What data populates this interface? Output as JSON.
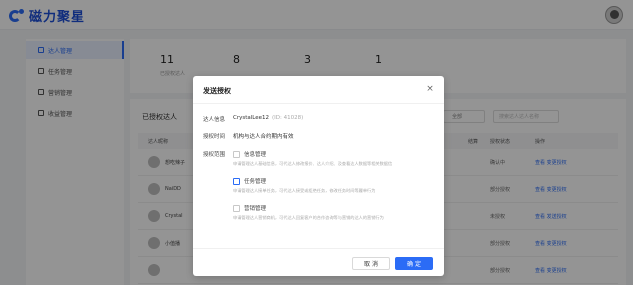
{
  "app": {
    "brand": "磁力聚星"
  },
  "sidebar": {
    "items": [
      {
        "label": "达人管理",
        "active": true
      },
      {
        "label": "任务管理",
        "active": false
      },
      {
        "label": "营销管理",
        "active": false
      },
      {
        "label": "收益管理",
        "active": false
      }
    ]
  },
  "stats": [
    {
      "value": "11",
      "label": "已授权达人"
    },
    {
      "value": "8",
      "label": ""
    },
    {
      "value": "3",
      "label": ""
    },
    {
      "value": "1",
      "label": ""
    }
  ],
  "list": {
    "title": "已授权达人",
    "filter_value": "全部",
    "search_placeholder": "搜索达人达人名称",
    "columns": {
      "name": "达人昵称",
      "settle": "结算",
      "status": "授权状态",
      "action": "操作"
    },
    "rows": [
      {
        "name": "想吃辣子",
        "status": "确认中",
        "op": "查看 变更授权"
      },
      {
        "name": "NaiDD",
        "status": "部分授权",
        "op": "查看 变更授权"
      },
      {
        "name": "Crystal",
        "status": "未授权",
        "op": "查看 发送授权"
      },
      {
        "name": "小值播",
        "status": "部分授权",
        "op": "查看 变更授权"
      },
      {
        "name": "",
        "status": "部分授权",
        "op": "查看 变更授权"
      }
    ]
  },
  "modal": {
    "title": "发送授权",
    "close_symbol": "×",
    "info_label": "达人信息",
    "info_name": "CrystalLee12",
    "info_id": "(ID: 41028)",
    "time_label": "授权时间",
    "time_value": "机构与达人合约期内有效",
    "scope_label": "授权范围",
    "perms": [
      {
        "label": "信息管理",
        "desc": "申请管理达人基础信息，可代达人修改报价、达人介绍、及查看达人数据等相关数据信"
      },
      {
        "label": "任务管理",
        "desc": "申请管理达人接单任务，可代达人接受或拒绝任务，修改任务时间等履单行为"
      },
      {
        "label": "营销管理",
        "desc": "申请管理达人营销商机，可代达人回复客户的合作咨询等与营销的达人的营销行为"
      }
    ],
    "cancel_label": "取 消",
    "ok_label": "确 定"
  }
}
